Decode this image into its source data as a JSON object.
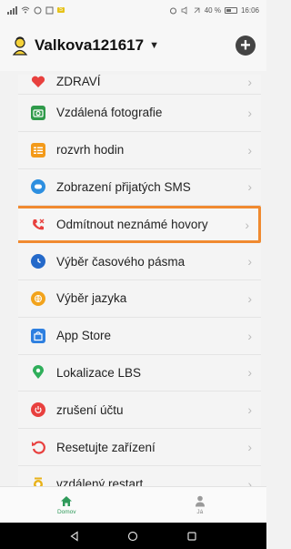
{
  "status_bar": {
    "sim_badge": "Š",
    "battery_text": "40 %",
    "time": "16:06"
  },
  "header": {
    "account_name": "Valkova121617",
    "caret": "▼",
    "add_label": "+"
  },
  "menu": {
    "items": [
      {
        "label": "ZDRAVÍ",
        "icon": "heart-icon",
        "color": "#e8403e"
      },
      {
        "label": "Vzdálená fotografie",
        "icon": "camera-icon",
        "color": "#2f9a4a"
      },
      {
        "label": "rozvrh hodin",
        "icon": "schedule-icon",
        "color": "#f39a1a"
      },
      {
        "label": "Zobrazení přijatých SMS",
        "icon": "sms-icon",
        "color": "#2d8fe0"
      },
      {
        "label": "Odmítnout neznámé hovory",
        "icon": "reject-call-icon",
        "color": "#e8403e"
      },
      {
        "label": "Výběr časového pásma",
        "icon": "clock-icon",
        "color": "#2469c9"
      },
      {
        "label": "Výběr jazyka",
        "icon": "language-icon",
        "color": "#f2a31c"
      },
      {
        "label": "App Store",
        "icon": "bag-icon",
        "color": "#2d7fe0"
      },
      {
        "label": "Lokalizace LBS",
        "icon": "location-icon",
        "color": "#2fae5a"
      },
      {
        "label": "zrušení účtu",
        "icon": "power-icon",
        "color": "#e8403e"
      },
      {
        "label": "Resetujte zařízení",
        "icon": "reset-icon",
        "color": "#e8403e"
      },
      {
        "label": "vzdálený restart",
        "icon": "restart-icon",
        "color": "#e8b21a"
      }
    ],
    "chevron": "›",
    "highlighted_index": 4,
    "highlight_color": "#f08a30"
  },
  "bottom_nav": {
    "tabs": [
      {
        "label": "Domov",
        "icon": "home-icon",
        "active": true
      },
      {
        "label": "Já",
        "icon": "person-icon",
        "active": false
      }
    ],
    "active_color": "#2f9a5a"
  },
  "android_nav": {
    "buttons": [
      "back-icon",
      "home-circle-icon",
      "recents-icon"
    ]
  }
}
